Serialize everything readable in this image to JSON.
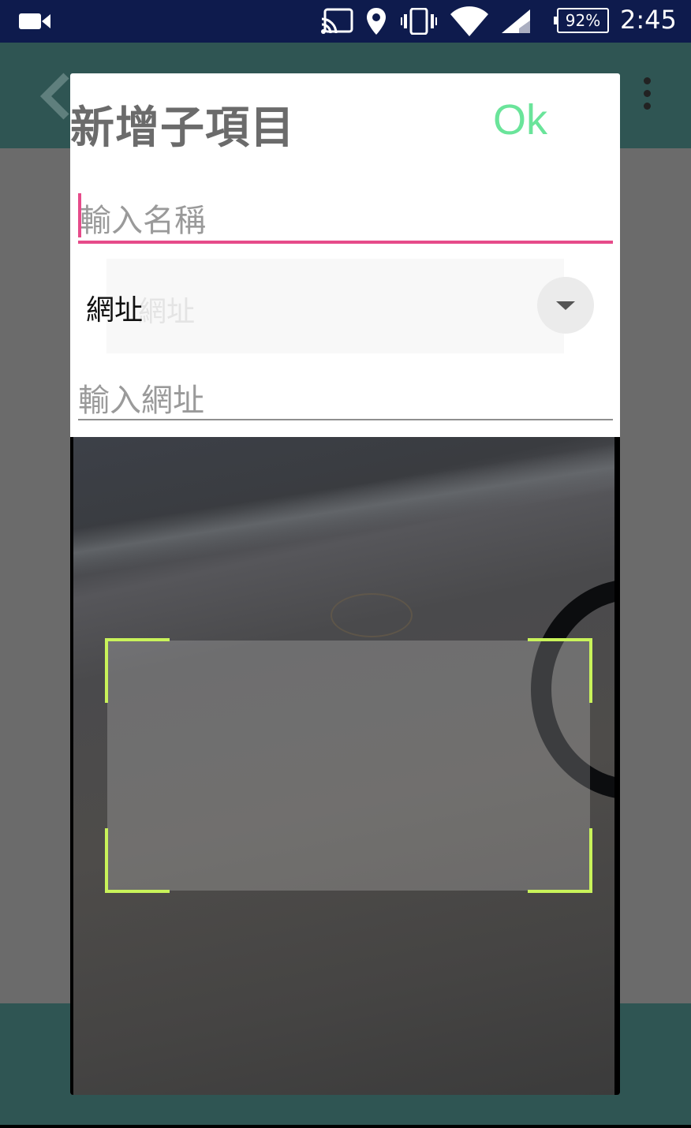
{
  "status_bar": {
    "icons": [
      "video-camera-icon",
      "cast-icon",
      "location-pin-icon",
      "vibrate-icon",
      "wifi-icon",
      "cell-signal-icon"
    ],
    "battery": "92%",
    "time": "2:45"
  },
  "dialog": {
    "title": "新增子項目",
    "ok_label": "Ok",
    "name_placeholder": "輸入名稱",
    "type_value": "網址",
    "type_ghost": "網址",
    "url_placeholder": "輸入網址"
  },
  "colors": {
    "status_bar": "#0e1b4d",
    "toolbar": "#2f5553",
    "accent_pink": "#e64b8a",
    "ok_green": "#6ae49a",
    "scan_corner": "#c9f35a"
  }
}
